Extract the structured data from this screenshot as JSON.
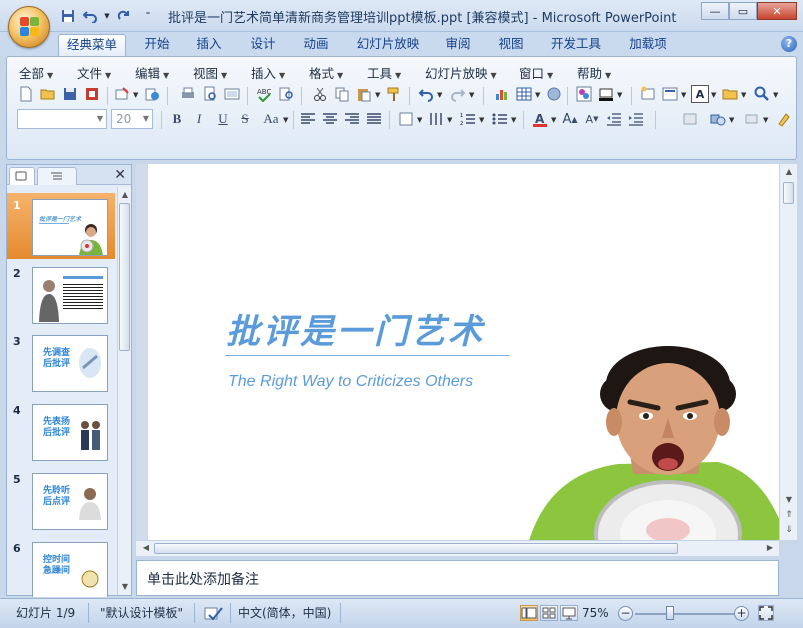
{
  "window": {
    "title": "批评是一门艺术简单清新商务管理培训ppt模板.ppt [兼容模式] - Microsoft PowerPoint",
    "minimize": "—",
    "restore": "▭",
    "close": "✕"
  },
  "ribbon_tabs": [
    "经典菜单",
    "开始",
    "插入",
    "设计",
    "动画",
    "幻灯片放映",
    "审阅",
    "视图",
    "开发工具",
    "加载项"
  ],
  "help_label": "?",
  "menu": {
    "all": "全部",
    "file": "文件",
    "edit": "编辑",
    "view": "视图",
    "insert": "插入",
    "format": "格式",
    "tools": "工具",
    "slideshow": "幻灯片放映",
    "window": "窗口",
    "help": "帮助"
  },
  "font": {
    "name": "",
    "size": "20"
  },
  "format_buttons": {
    "bold": "B",
    "italic": "I",
    "underline": "U",
    "shadow": "S",
    "case": "Aa"
  },
  "thumbnails": [
    {
      "num": "1",
      "title": "批评是一门艺术",
      "selected": true
    },
    {
      "num": "2",
      "title": "",
      "selected": false
    },
    {
      "num": "3",
      "title": "先调查后批评",
      "selected": false
    },
    {
      "num": "4",
      "title": "先表扬后批评",
      "selected": false
    },
    {
      "num": "5",
      "title": "先聆听后点评",
      "selected": false
    },
    {
      "num": "6",
      "title": "控时间急躁间",
      "selected": false
    }
  ],
  "slide": {
    "title": "批评是一门艺术",
    "subtitle": "The Right Way to Criticizes Others"
  },
  "notes_placeholder": "单击此处添加备注",
  "status": {
    "slide_info": "幻灯片 1/9",
    "theme": "\"默认设计模板\"",
    "language": "中文(简体，中国)",
    "zoom": "75%"
  },
  "colors": {
    "accent": "#5b9bd9",
    "selected_thumb": "#e58a2f",
    "ribbon_bg": "#dde8f5"
  }
}
